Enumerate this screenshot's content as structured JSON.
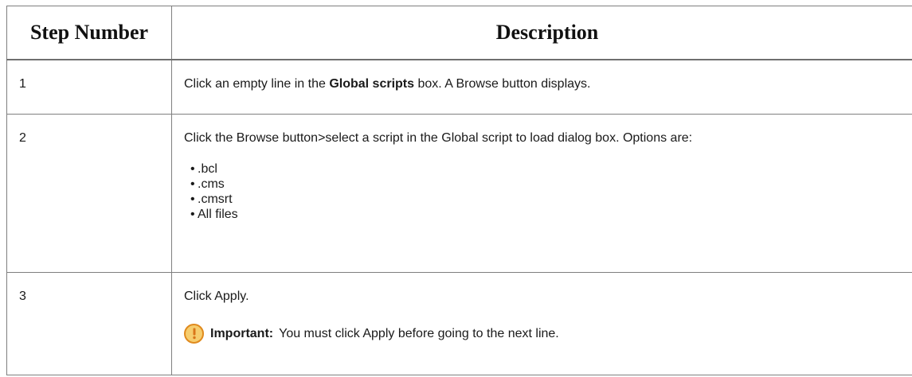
{
  "table": {
    "headers": [
      "Step Number",
      "Description"
    ],
    "rows": [
      {
        "step": "1",
        "text_before": "Click an empty line in the ",
        "text_bold": "Global scripts",
        "text_after": " box. A Browse button displays."
      },
      {
        "step": "2",
        "text": "Click the Browse button>select a script in the Global script to load dialog box. Options are:",
        "bullet": "•",
        "options": [
          ".bcl",
          ".cms",
          ".cmsrt",
          "All files"
        ]
      },
      {
        "step": "3",
        "text": "Click Apply.",
        "note": {
          "icon": "important-icon",
          "label": "Important:",
          "text": "You must click Apply before going to the next line."
        }
      }
    ]
  },
  "colors": {
    "border": "#7f7f7f",
    "icon_fill": "#f6cd6e",
    "icon_stroke": "#e08a1e"
  }
}
